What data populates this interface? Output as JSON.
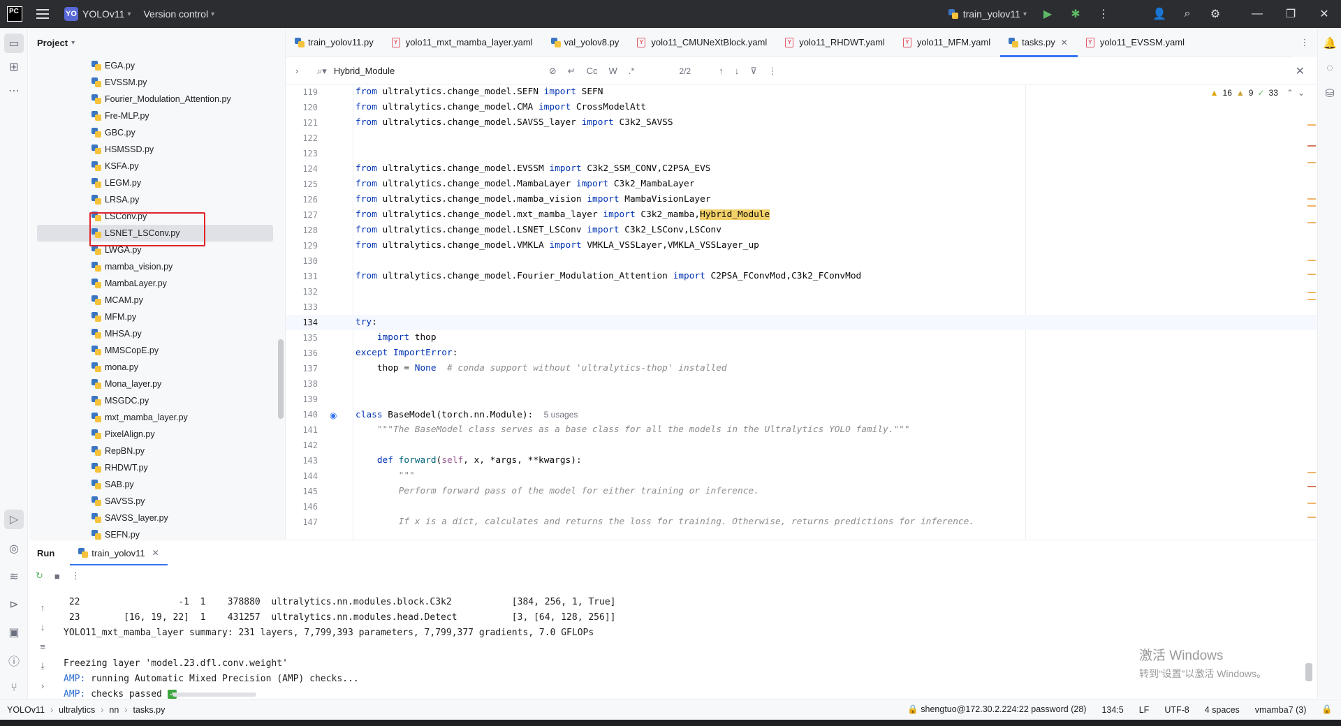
{
  "titlebar": {
    "project_badge": "YO",
    "project_name": "YOLOv11",
    "vcs": "Version control",
    "run_config": "train_yolov11"
  },
  "project_panel": {
    "title": "Project",
    "files": [
      "EGA.py",
      "EVSSM.py",
      "Fourier_Modulation_Attention.py",
      "Fre-MLP.py",
      "GBC.py",
      "HSMSSD.py",
      "KSFA.py",
      "LEGM.py",
      "LRSA.py",
      "LSConv.py",
      "LSNET_LSConv.py",
      "LWGA.py",
      "mamba_vision.py",
      "MambaLayer.py",
      "MCAM.py",
      "MFM.py",
      "MHSA.py",
      "MMSCopE.py",
      "mona.py",
      "Mona_layer.py",
      "MSGDC.py",
      "mxt_mamba_layer.py",
      "PixelAlign.py",
      "RepBN.py",
      "RHDWT.py",
      "SAB.py",
      "SAVSS.py",
      "SAVSS_layer.py",
      "SEFN.py"
    ],
    "selected": "LSNET_LSConv.py"
  },
  "tabs": [
    {
      "label": "train_yolov11.py",
      "type": "py"
    },
    {
      "label": "yolo11_mxt_mamba_layer.yaml",
      "type": "yaml"
    },
    {
      "label": "val_yolov8.py",
      "type": "py"
    },
    {
      "label": "yolo11_CMUNeXtBlock.yaml",
      "type": "yaml"
    },
    {
      "label": "yolo11_RHDWT.yaml",
      "type": "yaml"
    },
    {
      "label": "yolo11_MFM.yaml",
      "type": "yaml"
    },
    {
      "label": "tasks.py",
      "type": "py",
      "active": true
    },
    {
      "label": "yolo11_EVSSM.yaml",
      "type": "yaml"
    }
  ],
  "find": {
    "query": "Hybrid_Module",
    "case_label": "Cc",
    "word_label": "W",
    "regex_label": ".*",
    "count": "2/2"
  },
  "inspections": {
    "warnings": "16",
    "weak_warnings": "9",
    "typos": "33"
  },
  "code_lines": [
    {
      "n": "119",
      "html": "<span class=\"kw\">from</span> ultralytics.change_model.SEFN <span class=\"kw\">import</span> SEFN"
    },
    {
      "n": "120",
      "html": "<span class=\"kw\">from</span> ultralytics.change_model.CMA <span class=\"kw\">import</span> CrossModelAtt"
    },
    {
      "n": "121",
      "html": "<span class=\"kw\">from</span> ultralytics.change_model.SAVSS_layer <span class=\"kw\">import</span> C3k2_SAVSS"
    },
    {
      "n": "122",
      "html": ""
    },
    {
      "n": "123",
      "html": ""
    },
    {
      "n": "124",
      "html": "<span class=\"kw\">from</span> ultralytics.change_model.EVSSM <span class=\"kw\">import</span> C3k2_SSM_CONV,C2PSA_EVS"
    },
    {
      "n": "125",
      "html": "<span class=\"kw\">from</span> ultralytics.change_model.MambaLayer <span class=\"kw\">import</span> C3k2_MambaLayer"
    },
    {
      "n": "126",
      "html": "<span class=\"kw\">from</span> ultralytics.change_model.mamba_vision <span class=\"kw\">import</span> MambaVisionLayer"
    },
    {
      "n": "127",
      "html": "<span class=\"kw\">from</span> ultralytics.change_model.mxt_mamba_layer <span class=\"kw\">import</span> C3k2_mamba,<span class=\"hl\">Hybrid_Module</span>"
    },
    {
      "n": "128",
      "html": "<span class=\"kw\">from</span> ultralytics.change_model.LSNET_LSConv <span class=\"kw\">import</span> C3k2_LSConv,LSConv"
    },
    {
      "n": "129",
      "html": "<span class=\"kw\">from</span> ultralytics.change_model.VMKLA <span class=\"kw\">import</span> VMKLA_VSSLayer,VMKLA_VSSLayer_up"
    },
    {
      "n": "130",
      "html": ""
    },
    {
      "n": "131",
      "html": "<span class=\"kw\">from</span> ultralytics.change_model.Fourier_Modulation_Attention <span class=\"kw\">import</span> C2PSA_FConvMod,C3k2_FConvMod"
    },
    {
      "n": "132",
      "html": ""
    },
    {
      "n": "133",
      "html": ""
    },
    {
      "n": "134",
      "html": "<span class=\"kw\">try</span>:",
      "current": true
    },
    {
      "n": "135",
      "html": "    <span class=\"kw\">import</span> thop"
    },
    {
      "n": "136",
      "html": "<span class=\"kw\">except</span> <span class=\"kw\">ImportError</span>:"
    },
    {
      "n": "137",
      "html": "    thop = <span class=\"kw\">None</span>  <span class=\"cm\"># conda support without 'ultralytics-thop' installed</span>"
    },
    {
      "n": "138",
      "html": ""
    },
    {
      "n": "139",
      "html": ""
    },
    {
      "n": "140",
      "html": "<span class=\"kw\">class</span> BaseModel(torch.nn.Module):  <span class=\"usage\">5 usages</span>"
    },
    {
      "n": "141",
      "html": "    <span class=\"doc\">\"\"\"The BaseModel class serves as a base class for all the models in the Ultralytics YOLO family.\"\"\"</span>"
    },
    {
      "n": "142",
      "html": ""
    },
    {
      "n": "143",
      "html": "    <span class=\"kw\">def</span> <span class=\"fn\">forward</span>(<span class=\"sf\">self</span>, x, *args, **kwargs):"
    },
    {
      "n": "144",
      "html": "        <span class=\"doc\">\"\"\"</span>"
    },
    {
      "n": "145",
      "html": "        <span class=\"doc\">Perform forward pass of the model for either training or inference.</span>"
    },
    {
      "n": "146",
      "html": ""
    },
    {
      "n": "147",
      "html": "        <span class=\"doc\">If x is a dict, calculates and returns the loss for training. Otherwise, returns predictions for inference.</span>"
    }
  ],
  "run_panel": {
    "title": "Run",
    "tab": "train_yolov11",
    "console": [
      {
        "text": " 22                  -1  1    378880  ultralytics.nn.modules.block.C3k2           [384, 256, 1, True]"
      },
      {
        "text": " 23        [16, 19, 22]  1    431257  ultralytics.nn.modules.head.Detect          [3, [64, 128, 256]]"
      },
      {
        "text": "YOLO11_mxt_mamba_layer summary: 231 layers, 7,799,393 parameters, 7,799,377 gradients, 7.0 GFLOPs"
      },
      {
        "text": ""
      },
      {
        "text": "Freezing layer 'model.23.dfl.conv.weight'"
      },
      {
        "prefix": "AMP:",
        "text": " running Automatic Mixed Precision (AMP) checks..."
      },
      {
        "prefix": "AMP:",
        "text": " checks passed ",
        "ok": true
      }
    ],
    "watermark_1": "激活 Windows",
    "watermark_2": "转到“设置”以激活 Windows。"
  },
  "statusbar": {
    "crumbs": [
      "YOLOv11",
      "ultralytics",
      "nn",
      "tasks.py"
    ],
    "remote": "shengtuo@172.30.2.224:22 password (28)",
    "position": "134:5",
    "line_sep": "LF",
    "encoding": "UTF-8",
    "indent": "4 spaces",
    "interpreter": "vmamba7 (3)"
  }
}
